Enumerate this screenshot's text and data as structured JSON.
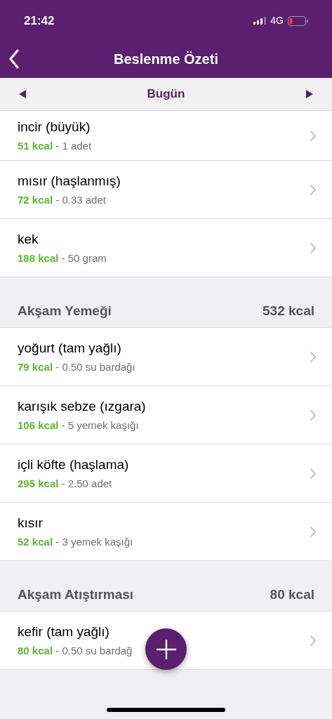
{
  "status_bar": {
    "time": "21:42",
    "network": "4G"
  },
  "nav": {
    "title": "Beslenme Özeti"
  },
  "date_bar": {
    "label": "Bugün"
  },
  "sections": [
    {
      "items": [
        {
          "name": "incir (büyük)",
          "kcal": "51 kcal",
          "amount": "- 1 adet"
        },
        {
          "name": "mısır (haşlanmış)",
          "kcal": "72 kcal",
          "amount": "- 0.33 adet"
        },
        {
          "name": "kek",
          "kcal": "188 kcal",
          "amount": "- 50 gram"
        }
      ]
    },
    {
      "title": "Akşam Yemeği",
      "total": "532 kcal",
      "items": [
        {
          "name": "yoğurt (tam yağlı)",
          "kcal": "79 kcal",
          "amount": "- 0.50 su bardağı"
        },
        {
          "name": "karışık sebze (ızgara)",
          "kcal": "106 kcal",
          "amount": "- 5 yemek kaşığı"
        },
        {
          "name": "içli köfte (haşlama)",
          "kcal": "295 kcal",
          "amount": "- 2.50 adet"
        },
        {
          "name": "kısır",
          "kcal": "52 kcal",
          "amount": "- 3 yemek kaşığı"
        }
      ]
    },
    {
      "title": "Akşam Atıştırması",
      "total": "80 kcal",
      "items": [
        {
          "name": "kefir (tam yağlı)",
          "kcal": "80 kcal",
          "amount": "- 0.50 su bardağ"
        }
      ]
    }
  ]
}
